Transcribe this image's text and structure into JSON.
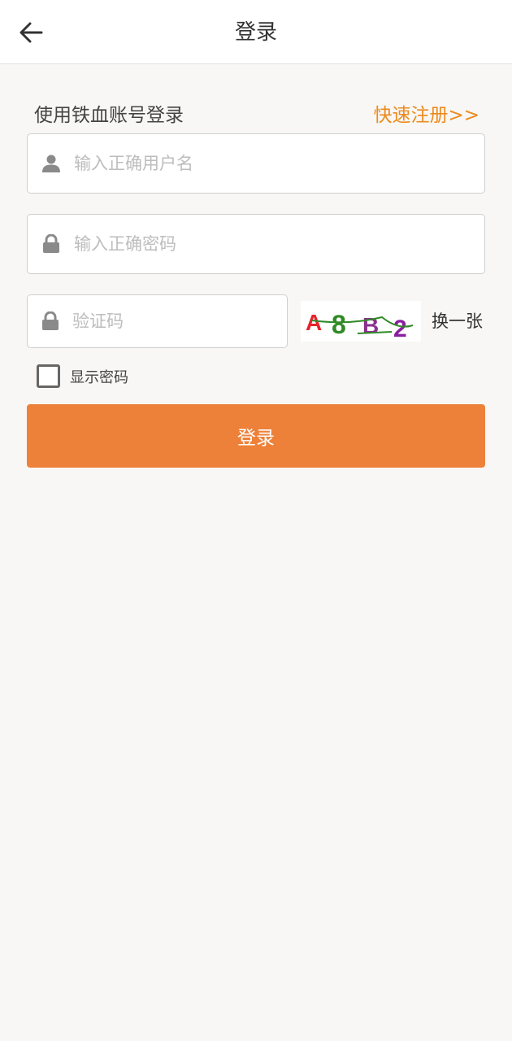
{
  "header": {
    "title": "登录",
    "back_icon": "arrow-left-icon"
  },
  "login_form": {
    "subtitle": "使用铁血账号登录",
    "register_link": "快速注册>>",
    "username": {
      "value": "",
      "placeholder": "输入正确用户名",
      "icon": "user-icon"
    },
    "password": {
      "value": "",
      "placeholder": "输入正确密码",
      "icon": "lock-icon"
    },
    "captcha": {
      "value": "",
      "placeholder": "验证码",
      "icon": "lock-icon",
      "image_text": "A8B2",
      "refresh_label": "换一张"
    },
    "show_password": {
      "label": "显示密码",
      "checked": false
    },
    "submit_label": "登录"
  },
  "colors": {
    "accent": "#ed8139",
    "link": "#ec8b1f",
    "background": "#f8f7f5"
  }
}
